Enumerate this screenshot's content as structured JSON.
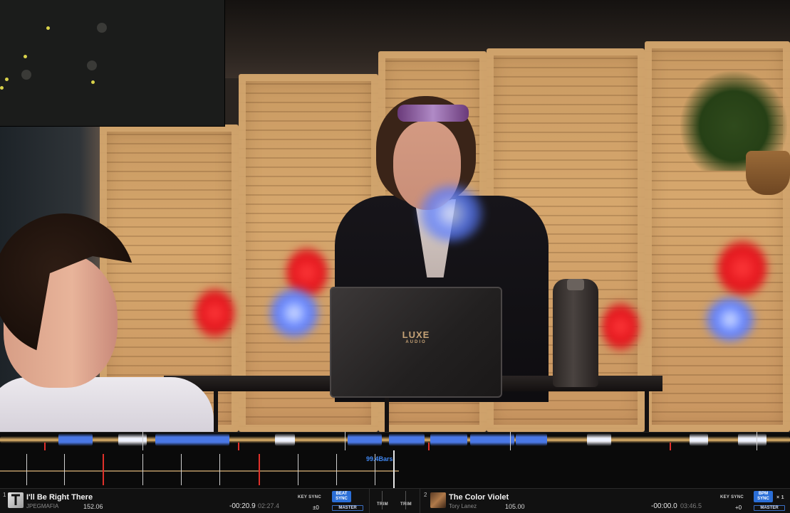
{
  "waveform": {
    "bars_label": "99.4Bars"
  },
  "laptop": {
    "brand": "LUXE",
    "sub": "AUDIO"
  },
  "deck1": {
    "number": "1",
    "title": "I'll Be Right There",
    "artist": "JPEGMAFIA",
    "bpm": "152.06",
    "elapsed": "-00:20.9",
    "remaining": "02:27.4",
    "key_sync_label": "KEY SYNC",
    "key_value": "±0",
    "sync_label_top": "BEAT",
    "sync_label_bottom": "SYNC",
    "master_label": "MASTER",
    "trim_a": "TRIM",
    "trim_b": "TRIM"
  },
  "deck2": {
    "number": "2",
    "title": "The Color Violet",
    "artist": "Tory Lanez",
    "bpm": "105.00",
    "elapsed": "-00:00.0",
    "remaining": "03:46.5",
    "key_sync_label": "KEY SYNC",
    "key_value": "+0",
    "sync_label_top": "BPM",
    "sync_label_bottom": "SYNC",
    "master_label": "MASTER",
    "multiplier": "× 1"
  },
  "colors": {
    "accent_blue": "#2b6fd8",
    "waveform_blue": "#4a78e6",
    "waveform_gold": "#c9a060",
    "cue_red": "#e0302a"
  }
}
